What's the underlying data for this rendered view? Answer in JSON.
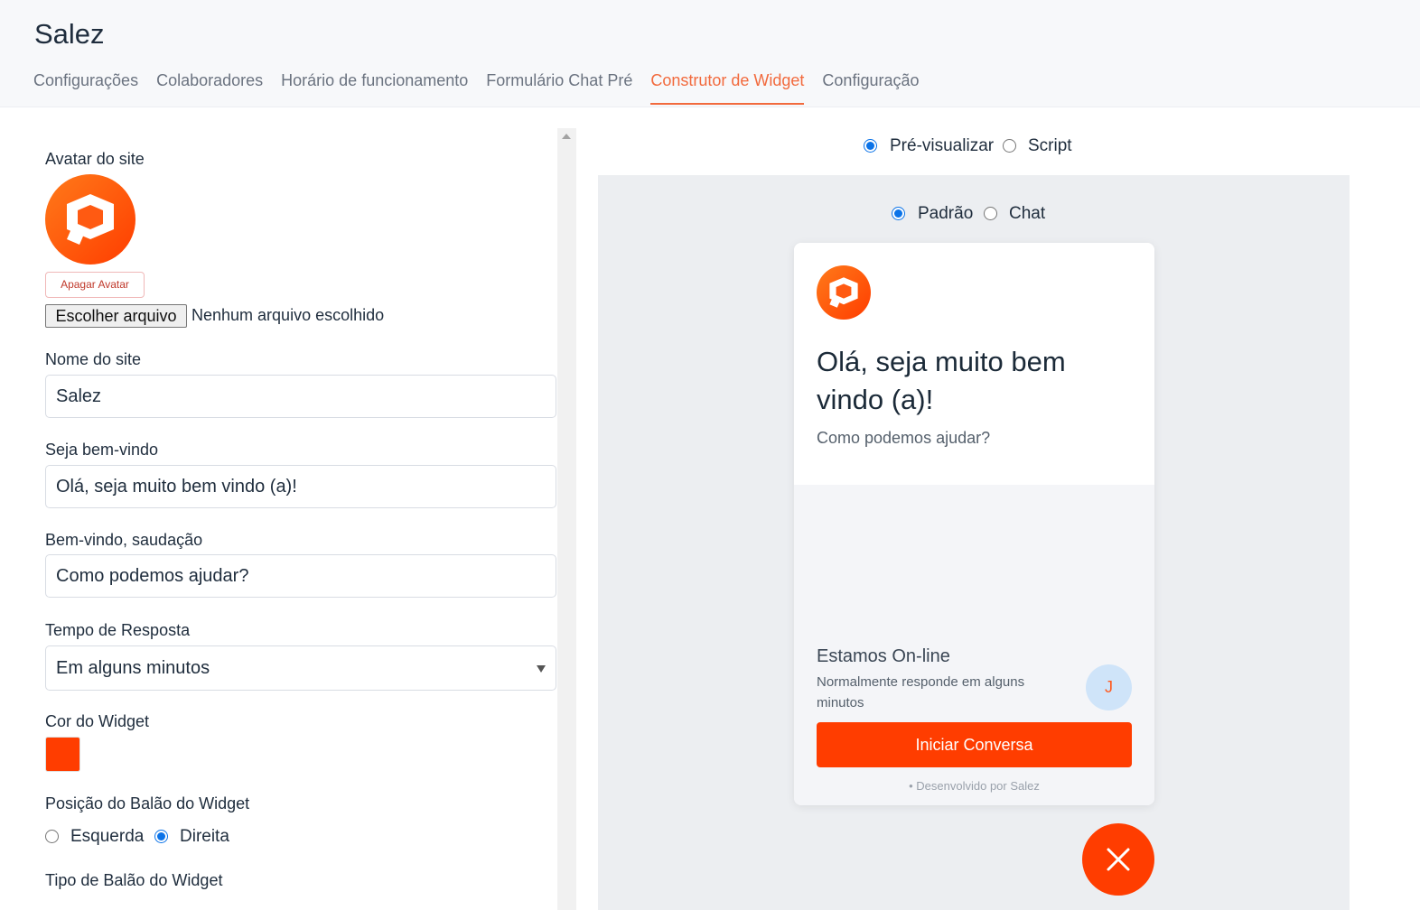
{
  "app": {
    "title": "Salez"
  },
  "tabs": [
    {
      "label": "Configurações",
      "active": false
    },
    {
      "label": "Colaboradores",
      "active": false
    },
    {
      "label": "Horário de funcionamento",
      "active": false
    },
    {
      "label": "Formulário Chat Pré",
      "active": false
    },
    {
      "label": "Construtor de Widget",
      "active": true
    },
    {
      "label": "Configuração",
      "active": false
    }
  ],
  "form": {
    "avatar_label": "Avatar do site",
    "delete_avatar_label": "Apagar Avatar",
    "file_button_label": "Escolher arquivo",
    "file_status": "Nenhum arquivo escolhido",
    "site_name_label": "Nome do site",
    "site_name_value": "Salez",
    "welcome_label": "Seja bem-vindo",
    "welcome_value": "Olá, seja muito bem vindo (a)!",
    "greeting_label": "Bem-vindo, saudação",
    "greeting_value": "Como podemos ajudar?",
    "response_time_label": "Tempo de Resposta",
    "response_time_value": "Em alguns minutos",
    "widget_color_label": "Cor do Widget",
    "widget_color": "#ff3d00",
    "bubble_position_label": "Posição do Balão do Widget",
    "bubble_position_options": [
      {
        "label": "Esquerda",
        "selected": false
      },
      {
        "label": "Direita",
        "selected": true
      }
    ],
    "bubble_type_label": "Tipo de Balão do Widget"
  },
  "view_toggle": [
    {
      "label": "Pré-visualizar",
      "selected": true
    },
    {
      "label": "Script",
      "selected": false
    }
  ],
  "preview_mode": [
    {
      "label": "Padrão",
      "selected": true
    },
    {
      "label": "Chat",
      "selected": false
    }
  ],
  "widget": {
    "title": "Olá, seja muito bem vindo (a)!",
    "subtitle": "Como podemos ajudar?",
    "status_title": "Estamos On-line",
    "status_subtitle": "Normalmente responde em alguns minutos",
    "agent_initial": "J",
    "start_button": "Iniciar Conversa",
    "powered_by": "Desenvolvido por Salez",
    "launcher_icon": "close-icon"
  },
  "colors": {
    "accent": "#ff3d00",
    "tab_active": "#f26a3d",
    "radio": "#0b73e8"
  }
}
